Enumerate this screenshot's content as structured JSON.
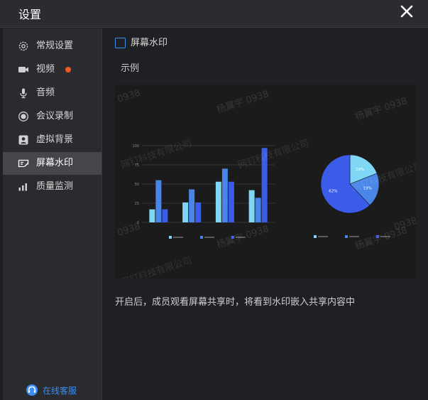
{
  "window": {
    "title": "设置"
  },
  "sidebar": {
    "items": [
      {
        "label": "常规设置",
        "icon": "gear-icon"
      },
      {
        "label": "视频",
        "icon": "video-camera-icon",
        "badge_color": "#f05a22"
      },
      {
        "label": "音频",
        "icon": "microphone-icon"
      },
      {
        "label": "会议录制",
        "icon": "record-icon"
      },
      {
        "label": "虚拟背景",
        "icon": "portrait-icon"
      },
      {
        "label": "屏幕水印",
        "icon": "watermark-icon",
        "active": true
      },
      {
        "label": "质量监测",
        "icon": "signal-bars-icon"
      }
    ],
    "service": {
      "label": "在线客服",
      "icon": "headset-icon"
    }
  },
  "content": {
    "watermark_checkbox_label": "屏幕水印",
    "watermark_checked": false,
    "example_label": "示例",
    "description": "开启后，成员观看屏幕共享时，将看到水印嵌入共享内容中"
  },
  "preview": {
    "watermark_texts": [
      "杨翼宇 0938",
      "杨翼宇 0938",
      "杨翼宇 0938",
      "杨翼宇 0938",
      "0938",
      "0938",
      "0938"
    ],
    "company_texts": [
      "网钉科技有限公司",
      "网钉科技有限公司",
      "网钉科技有限公司",
      "网钉科技有限公司"
    ],
    "chart_data": [
      {
        "type": "bar",
        "categories": [
          "",
          "",
          "",
          ""
        ],
        "series": [
          {
            "name": "",
            "values": [
              17,
              26,
              53,
              42
            ],
            "color": "#7fd6f5"
          },
          {
            "name": "",
            "values": [
              55,
              43,
              70,
              32
            ],
            "color": "#4a86e8"
          },
          {
            "name": "",
            "values": [
              17,
              26,
              53,
              97
            ],
            "color": "#3a5ce8"
          }
        ],
        "yticks": [
          "100",
          "75",
          "50",
          "25",
          "0"
        ],
        "ylim": [
          0,
          100
        ],
        "legend_position": "bottom"
      },
      {
        "type": "pie",
        "values": [
          19,
          19,
          62
        ],
        "labels": [
          "19%",
          "19%",
          "62%"
        ],
        "colors": [
          "#7fd6f5",
          "#4a86e8",
          "#3a5ce8"
        ],
        "legend_position": "bottom"
      }
    ]
  }
}
